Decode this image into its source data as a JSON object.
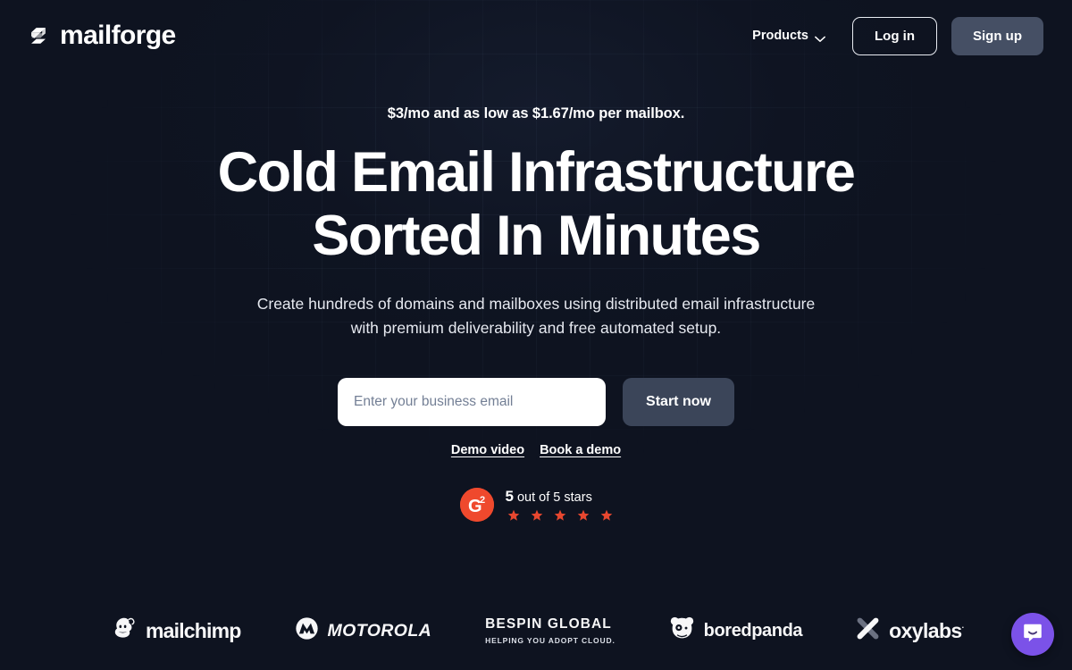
{
  "brand": {
    "name": "mailforge",
    "mark_icon": "mailforge-logo-icon"
  },
  "nav": {
    "products_label": "Products",
    "products_chevron_icon": "chevron-down-icon",
    "login_label": "Log in",
    "signup_label": "Sign up"
  },
  "hero": {
    "eyebrow": "$3/mo and as low as $1.67/mo per mailbox.",
    "headline_line1": "Cold Email Infrastructure",
    "headline_line2": "Sorted In Minutes",
    "subhead_line1": "Create hundreds of domains and mailboxes using distributed email",
    "subhead_line2": "infrastructure with premium deliverability and free automated setup."
  },
  "form": {
    "email_placeholder": "Enter your business email",
    "email_value": "",
    "submit_label": "Start now",
    "demo_video_label": "Demo video",
    "book_demo_label": "Book a demo"
  },
  "rating": {
    "badge_icon": "g2-badge-icon",
    "badge_text": "G2",
    "score": "5",
    "suffix": " out of 5 stars",
    "stars_count": 5,
    "star_icon": "star-icon",
    "star_color": "#e8472f",
    "badge_color": "#ef492d"
  },
  "logos": [
    {
      "name": "mailchimp",
      "icon": "mailchimp-monkey-icon",
      "wordmark": "mailchimp"
    },
    {
      "name": "motorola",
      "icon": "motorola-m-icon",
      "wordmark": "MOTOROLA"
    },
    {
      "name": "bespin-global",
      "wordmark": "BESPIN GLOBAL",
      "tagline": "HELPING YOU ADOPT CLOUD."
    },
    {
      "name": "boredpanda",
      "icon": "boredpanda-panda-icon",
      "wordmark": "boredpanda"
    },
    {
      "name": "oxylabs",
      "icon": "oxylabs-x-icon",
      "wordmark": "oxylabs",
      "registered": "·"
    }
  ],
  "chat": {
    "icon": "chat-bubble-icon",
    "color": "#7b52e8"
  },
  "theme": {
    "background": "#0e1320",
    "accent_button": "#3b4559",
    "text_primary": "#ffffff"
  }
}
